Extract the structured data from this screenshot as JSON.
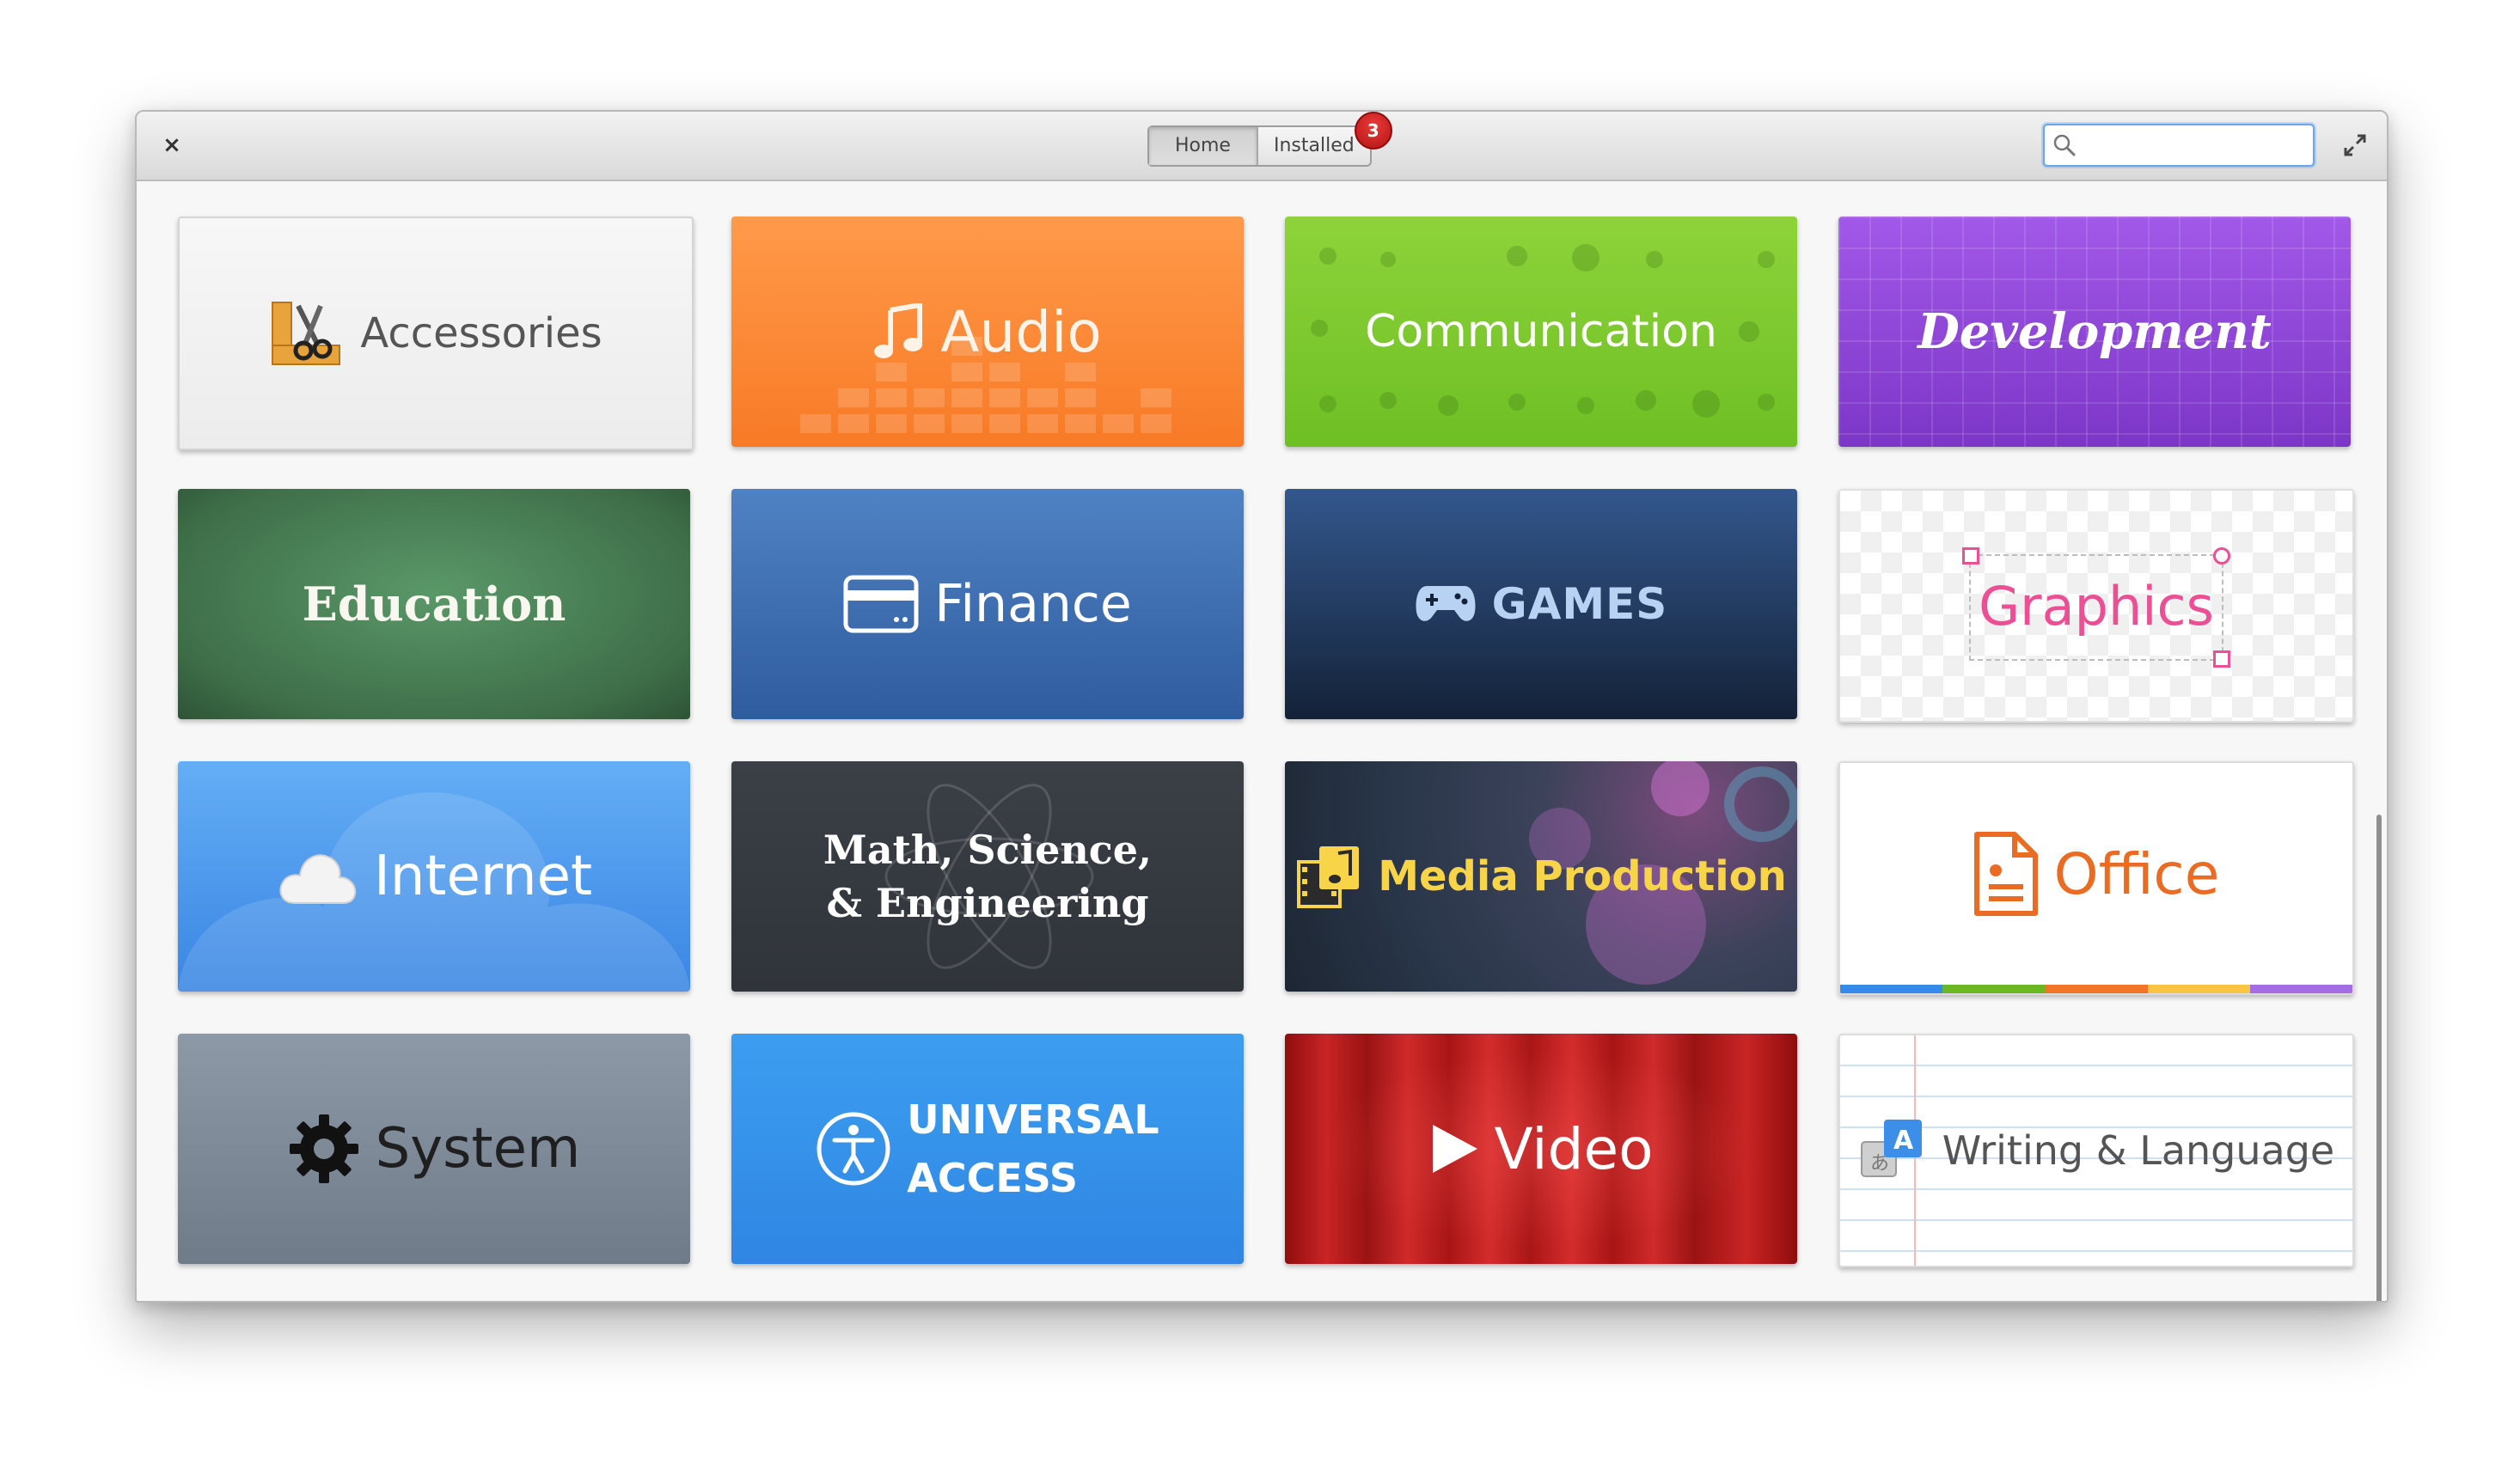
{
  "window": {
    "close_symbol": "×",
    "tabs": [
      {
        "label": "Home",
        "active": true
      },
      {
        "label": "Installed",
        "active": false,
        "badge": "3"
      }
    ],
    "search": {
      "value": "",
      "placeholder": ""
    }
  },
  "categories": [
    {
      "label": "Accessories",
      "icon": "scissors-ruler-icon"
    },
    {
      "label": "Audio",
      "icon": "music-note-icon"
    },
    {
      "label": "Communication",
      "icon": "none"
    },
    {
      "label": "Development",
      "icon": "none"
    },
    {
      "label": "Education",
      "icon": "none"
    },
    {
      "label": "Finance",
      "icon": "credit-card-icon"
    },
    {
      "label": "GAMES",
      "icon": "gamepad-icon"
    },
    {
      "label": "Graphics",
      "icon": "selection-box-icon"
    },
    {
      "label": "Internet",
      "icon": "cloud-icon"
    },
    {
      "label_line1": "Math, Science,",
      "label_line2": "& Engineering",
      "icon": "atom-icon"
    },
    {
      "label": "Media Production",
      "icon": "film-music-icon"
    },
    {
      "label": "Office",
      "icon": "document-icon"
    },
    {
      "label": "System",
      "icon": "gear-icon"
    },
    {
      "label_line1": "UNIVERSAL",
      "label_line2": "ACCESS",
      "icon": "accessibility-icon"
    },
    {
      "label": "Video",
      "icon": "play-icon"
    },
    {
      "label": "Writing & Language",
      "icon": "translate-icon"
    }
  ],
  "colors": {
    "badge": "#c81e1e",
    "search_focus": "#6aa6ea",
    "office_stripe": [
      "#3689e6",
      "#68b723",
      "#f37329",
      "#f9c440",
      "#a56de2"
    ]
  }
}
